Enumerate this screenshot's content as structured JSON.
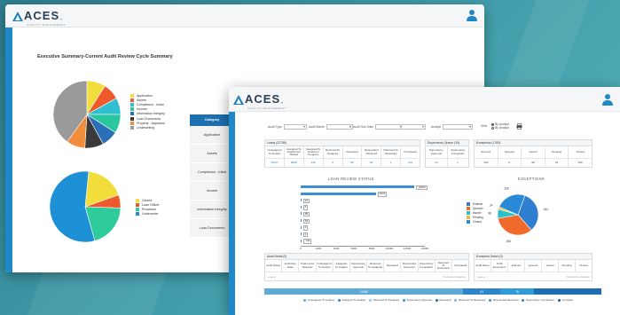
{
  "back_window": {
    "logo": {
      "text": "ACES",
      "tm": "™",
      "sub": "QUALITY MANAGEMENT"
    },
    "title": "Executive Summary-Current Audit Review Cycle Summary",
    "pie1_legend": [
      "Application",
      "Assets",
      "Compliance - Initial",
      "Income",
      "Information Integrity",
      "Loan Documents",
      "Property - Appraisal",
      "Underwriting"
    ],
    "pie2_legend": [
      "Closed",
      "Loan Officer",
      "Processor",
      "Underwriter"
    ],
    "category_table": {
      "header": "Category",
      "rows": [
        "Application",
        "Assets",
        "Compliance - Initial",
        "Income",
        "Information Integrity",
        "Loan Documents"
      ]
    }
  },
  "front_window": {
    "logo": {
      "text": "ACES",
      "tm": "™",
      "sub": "QUALITY MANAGEMENT"
    },
    "filters": {
      "audit_type": "Audit Type",
      "audit_name": "Audit Name",
      "audit_due_date": "Audit Due Date",
      "analyst": "Analyst",
      "view": "View",
      "radio1": "By Analyst",
      "radio2": "By Analyst"
    },
    "loans_panel": {
      "title": "Loans (22785)",
      "headers": [
        "Unassigned To Analyst",
        "Assigned To Analyst Not Started",
        "Assigned To Analyst In Progress",
        "Returned To Assigned",
        "Reviewed",
        "Responded Received",
        "Returned To Reviewed",
        "Completed"
      ],
      "values": [
        "12127",
        "8938",
        "249",
        "5",
        "89",
        "84",
        "1",
        "144"
      ]
    },
    "supervisory_panel": {
      "title": "Supervisory Queue (15)",
      "headers": [
        "Supervisory Approval",
        "Supervisory Completion"
      ],
      "values": [
        "13",
        "2"
      ]
    },
    "exceptions_panel": {
      "title": "Exceptions (1765)",
      "headers": [
        "Entered",
        "Queued",
        "Issued",
        "Pending",
        "Closed"
      ],
      "values": [
        "442",
        "0",
        "98",
        "24",
        "326"
      ]
    },
    "loan_review_chart_title": "LOAN REVIEW STATUS",
    "exceptions_chart_title": "EXCEPTIONS",
    "exceptions_legend": [
      "Entered",
      "Queued",
      "Issued",
      "Pending",
      "Closed"
    ],
    "exceptions_slice_labels": [
      "442",
      "450",
      "98",
      "24",
      "326"
    ],
    "audit_detail": {
      "title": "Audit Detail (0)",
      "headers": [
        "Audit Name",
        "Audit Due Date",
        "Total Loans Selected",
        "Unassigned To Analyst",
        "Assigned To Analyst",
        "Supervisory Approval",
        "Returned To Assigned",
        "Reviewed",
        "Responded Received",
        "Supervisory Completion",
        "Returned To Reviewed",
        "Completed"
      ],
      "empty": "No items to display"
    },
    "exception_detail": {
      "title": "Exception Detail (0)",
      "headers": [
        "Audit Name",
        "Total Exceptions",
        "Entered",
        "Queued",
        "Issued",
        "Pending",
        "Closed"
      ],
      "empty": "No items to display"
    },
    "summary_bar": [
      "21588",
      "63",
      "78",
      "",
      "",
      ""
    ],
    "bottom_legend": [
      "Unassigned To Analyst",
      "Assigned To Analyst",
      "Returned To Assigned",
      "Supervisory Approval",
      "Reviewed",
      "Returned To Reviewed",
      "Responded Received",
      "Supervisory Completion",
      "Complete"
    ]
  },
  "chart_data": [
    {
      "type": "pie",
      "labels": [
        "Application",
        "Assets",
        "Compliance - Initial",
        "Income",
        "Information Integrity",
        "Loan Documents",
        "Property - Appraisal",
        "Underwriting"
      ],
      "values": [
        9,
        8,
        8,
        9,
        8,
        9,
        9,
        40
      ],
      "colors": [
        "#f2de3b",
        "#ee5a2b",
        "#2fbfd0",
        "#28c7a0",
        "#2b6fb6",
        "#3a3a3a",
        "#f08c3a",
        "#9a9a9a"
      ]
    },
    {
      "type": "pie",
      "labels": [
        "Closed",
        "Loan Officer",
        "Processor",
        "Underwriter"
      ],
      "values": [
        18,
        6,
        20,
        56
      ],
      "colors": [
        "#f2de3b",
        "#ee5a2b",
        "#2ecc9a",
        "#1e90d6"
      ]
    },
    {
      "type": "bar",
      "title": "LOAN REVIEW STATUS",
      "orientation": "horizontal",
      "categories": [
        "0.Unassigned to Analyst",
        "1.Assigned to Analyst",
        "2.Supervisory Approval",
        "3.Returned To Assigned",
        "4.Reviewed",
        "5.Responded Received",
        "6.Supervisory Completion",
        "7.Returned To Reviewed",
        "8.Completed"
      ],
      "values": [
        12833,
        8474,
        13,
        5,
        89,
        84,
        2,
        1,
        144
      ],
      "xlim": [
        0,
        14000
      ],
      "xticks": [
        0,
        2000,
        4000,
        6000,
        8000,
        10000,
        12000,
        14000
      ]
    },
    {
      "type": "pie",
      "title": "EXCEPTIONS",
      "labels": [
        "Entered",
        "Queued",
        "Issued",
        "Pending",
        "Closed"
      ],
      "values": [
        442,
        450,
        98,
        24,
        326
      ],
      "colors": [
        "#2f7fd1",
        "#f06b2b",
        "#2ac0c9",
        "#f0c232",
        "#2a8ad8"
      ]
    }
  ]
}
